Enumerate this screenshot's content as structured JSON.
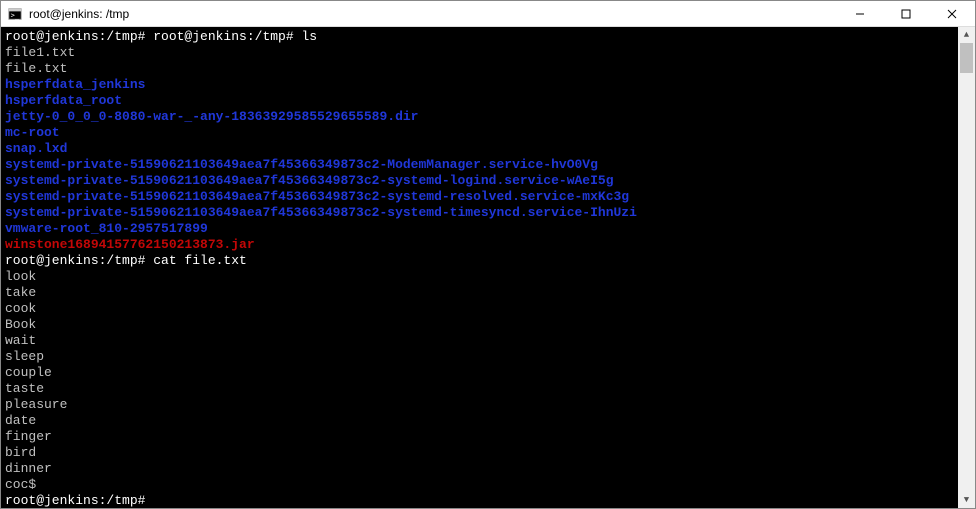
{
  "window": {
    "title": "root@jenkins: /tmp"
  },
  "term": {
    "prompt1": "root@jenkins:/tmp# root@jenkins:/tmp# ls",
    "ls_output": [
      {
        "text": "file1.txt",
        "cls": "fg-gray"
      },
      {
        "text": "file.txt",
        "cls": "fg-gray"
      },
      {
        "text": "hsperfdata_jenkins",
        "cls": "fg-blue"
      },
      {
        "text": "hsperfdata_root",
        "cls": "fg-blue"
      },
      {
        "text": "jetty-0_0_0_0-8080-war-_-any-18363929585529655589.dir",
        "cls": "fg-blue"
      },
      {
        "text": "mc-root",
        "cls": "fg-blue"
      },
      {
        "text": "snap.lxd",
        "cls": "fg-blue"
      },
      {
        "text": "systemd-private-51590621103649aea7f45366349873c2-ModemManager.service-hvO0Vg",
        "cls": "fg-blue"
      },
      {
        "text": "systemd-private-51590621103649aea7f45366349873c2-systemd-logind.service-wAeI5g",
        "cls": "fg-blue"
      },
      {
        "text": "systemd-private-51590621103649aea7f45366349873c2-systemd-resolved.service-mxKc3g",
        "cls": "fg-blue"
      },
      {
        "text": "systemd-private-51590621103649aea7f45366349873c2-systemd-timesyncd.service-IhnUzi",
        "cls": "fg-blue"
      },
      {
        "text": "vmware-root_810-2957517899",
        "cls": "fg-blue"
      },
      {
        "text": "winstone16894157762150213873.jar",
        "cls": "fg-red"
      }
    ],
    "prompt2": "root@jenkins:/tmp# cat file.txt",
    "cat_output": [
      "look",
      "take",
      "cook",
      "Book",
      "wait",
      "sleep",
      "couple",
      "taste",
      "pleasure",
      "date",
      "finger",
      "bird",
      "dinner",
      "coc$"
    ],
    "prompt3_user": "root@jenkins",
    "prompt3_path": ":/tmp#"
  }
}
